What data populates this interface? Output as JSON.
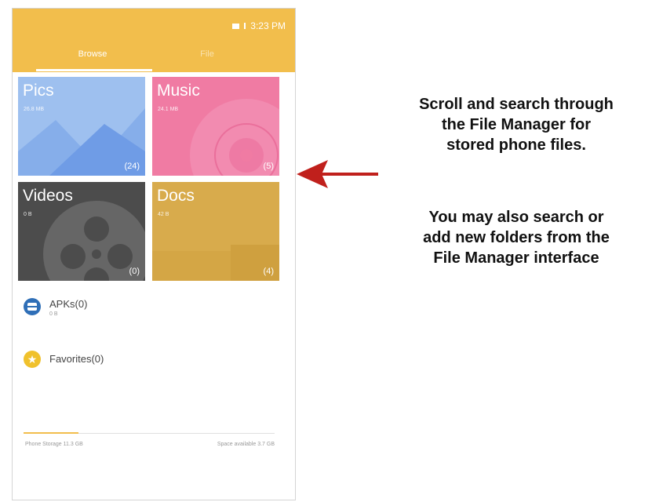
{
  "status_bar": {
    "time": "3:23 PM"
  },
  "tabs": [
    {
      "label": "Browse",
      "active": true
    },
    {
      "label": "File",
      "active": false
    }
  ],
  "categories": [
    {
      "title": "Pics",
      "subtitle": "26.8 MB",
      "count": "(24)"
    },
    {
      "title": "Music",
      "subtitle": "24.1 MB",
      "count": "(5)"
    },
    {
      "title": "Videos",
      "subtitle": "0 B",
      "count": "(0)"
    },
    {
      "title": "Docs",
      "subtitle": "42 B",
      "count": "(4)"
    }
  ],
  "list": [
    {
      "label": "APKs(0)",
      "sub": "0 B",
      "icon": "apk-icon"
    },
    {
      "label": "Favorites(0)",
      "icon": "star-icon"
    }
  ],
  "storage": {
    "left": "Phone Storage 11.3 GB",
    "right": "Space available 3.7 GB",
    "used_fraction": 0.22
  },
  "annotation": {
    "caption1": "Scroll and search through\nthe File Manager for\nstored phone files.",
    "caption2": "You may also search or\nadd new folders from the\nFile Manager interface"
  },
  "colors": {
    "header": "#f2be4c",
    "pics": "#9ec0ef",
    "music": "#f07ba3",
    "videos": "#4c4c4c",
    "docs": "#d8ab4c",
    "arrow": "#c0201c"
  }
}
